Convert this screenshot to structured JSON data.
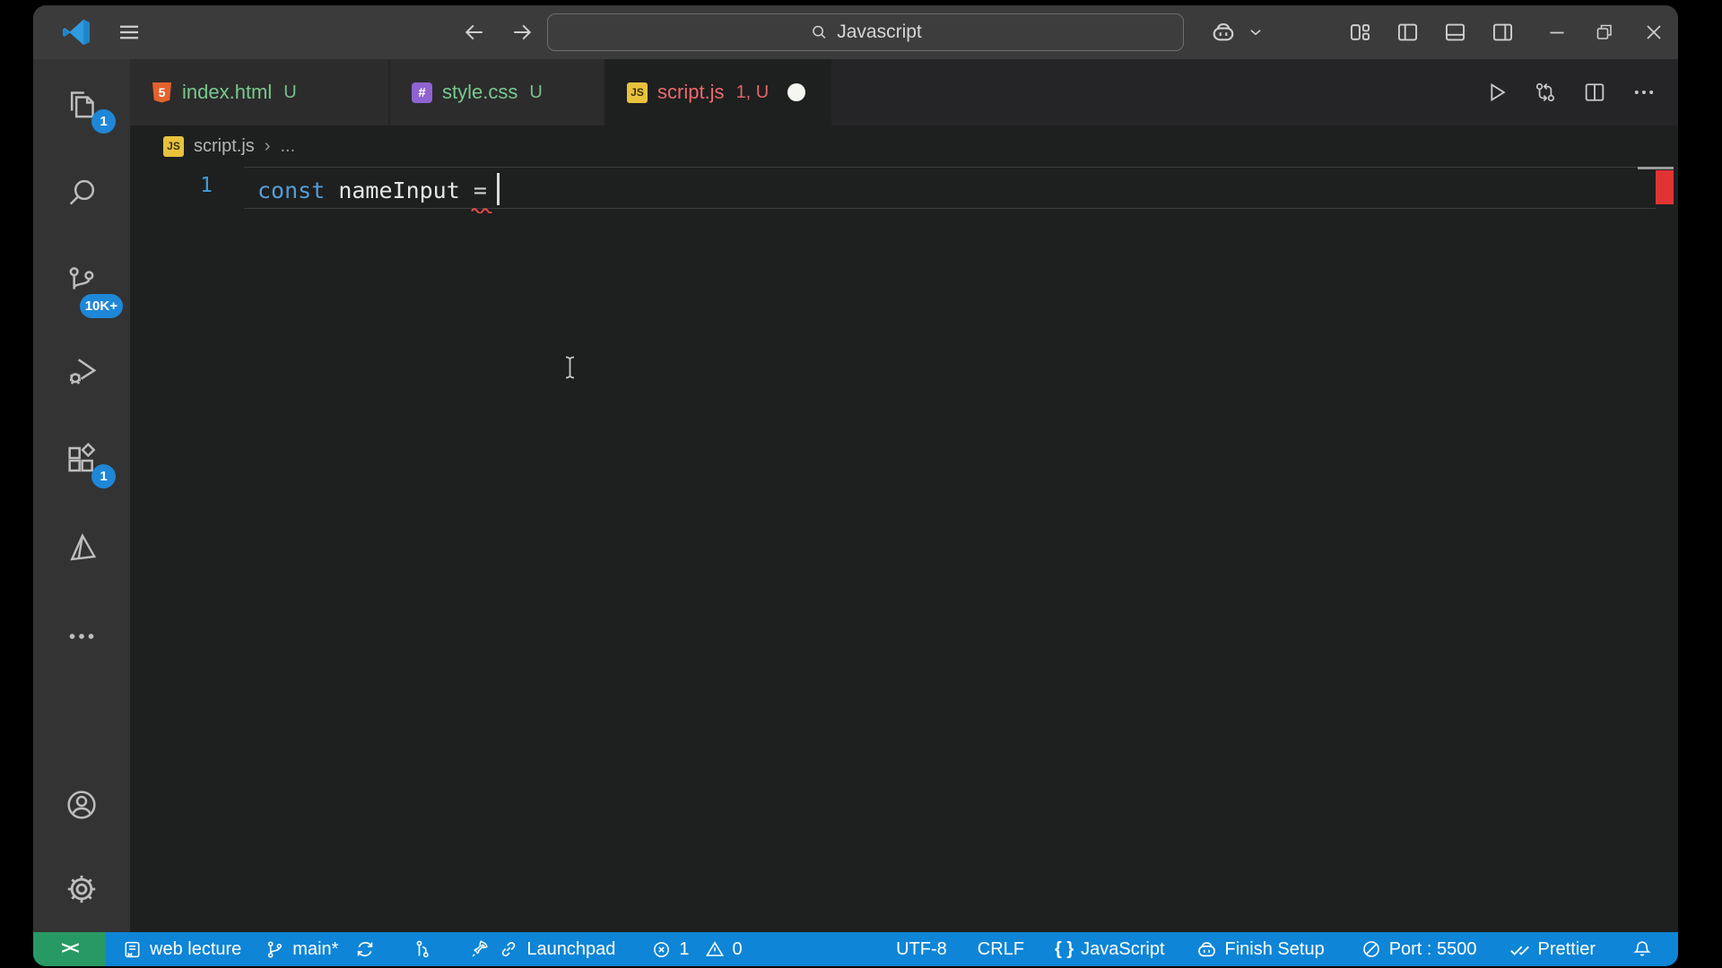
{
  "titlebar": {
    "search_label": "Javascript"
  },
  "tabs": {
    "index": {
      "name": "index.html",
      "badge": "U"
    },
    "style": {
      "name": "style.css",
      "badge": "U"
    },
    "script": {
      "name": "script.js",
      "badge": "1, U"
    }
  },
  "tab_icons": {
    "html": "5",
    "css": "#",
    "js": "JS"
  },
  "breadcrumb": {
    "file": "script.js",
    "chevron": "›",
    "more": "..."
  },
  "editor": {
    "line_number": "1",
    "code": {
      "keyword": "const",
      "variable": "nameInput",
      "operator": "="
    }
  },
  "activity_badges": {
    "explorer": "1",
    "source_control": "10K+",
    "extensions": "1"
  },
  "statusbar": {
    "remote": "><",
    "workspace": "web lecture",
    "branch": "main*",
    "launchpad": "Launchpad",
    "errors": "1",
    "warnings": "0",
    "encoding": "UTF-8",
    "eol": "CRLF",
    "braces": "{ }",
    "language": "JavaScript",
    "copilot_status": "Finish Setup",
    "port": "Port : 5500",
    "formatter": "Prettier"
  },
  "colors": {
    "statusbar_blue": "#0e85d6",
    "remote_green": "#279a63",
    "badge_blue": "#1f87d7",
    "untracked_green": "#79c98e",
    "error_tab_red": "#ec6a6e",
    "keyword_blue": "#569cd6",
    "linenumber_blue": "#3f9ed9",
    "overview_error_red": "#e23333",
    "squiggle_red": "#f14c4c",
    "js_yellow": "#e8c23d",
    "html_orange": "#e5622d",
    "css_purple": "#8f63d2"
  }
}
